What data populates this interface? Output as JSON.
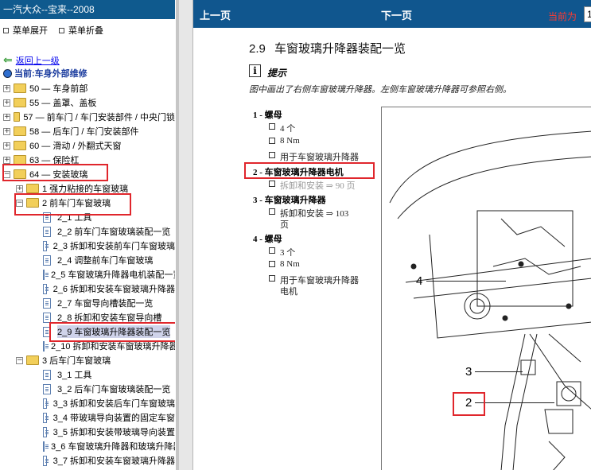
{
  "left": {
    "title": "一汽大众--宝来--2008",
    "menu": {
      "expand": "菜单展开",
      "collapse": "菜单折叠"
    },
    "back": "返回上一级",
    "current": "当前:车身外部维修",
    "tree": [
      {
        "toggle": "+",
        "label": "50 — 车身前部"
      },
      {
        "toggle": "+",
        "label": "55 — 盖罩、盖板"
      },
      {
        "toggle": "+",
        "label": "57 — 前车门 / 车门安装部件 / 中央门锁"
      },
      {
        "toggle": "+",
        "label": "58 — 后车门 / 车门安装部件"
      },
      {
        "toggle": "+",
        "label": "60 — 滑动 / 外翻式天窗"
      },
      {
        "toggle": "+",
        "label": "63 — 保险杠"
      },
      {
        "toggle": "−",
        "label": "64 — 安装玻璃"
      },
      {
        "toggle": "+",
        "label": "1 强力粘接的车窗玻璃"
      },
      {
        "toggle": "−",
        "label": "2 前车门车窗玻璃"
      },
      {
        "label": "2_1 工具"
      },
      {
        "label": "2_2 前车门车窗玻璃装配一览"
      },
      {
        "label": "2_3 拆卸和安装前车门车窗玻璃"
      },
      {
        "label": "2_4 调整前车门车窗玻璃"
      },
      {
        "label": "2_5 车窗玻璃升降器电机装配一览"
      },
      {
        "label": "2_6 拆卸和安装车窗玻璃升降器"
      },
      {
        "label": "2_7 车窗导向槽装配一览"
      },
      {
        "label": "2_8 拆卸和安装车窗导向槽"
      },
      {
        "label": "2_9 车窗玻璃升降器装配一览"
      },
      {
        "label": "2_10 拆卸和安装车窗玻璃升降器电机"
      },
      {
        "toggle": "−",
        "label": "3 后车门车窗玻璃"
      },
      {
        "label": "3_1 工具"
      },
      {
        "label": "3_2 后车门车窗玻璃装配一览"
      },
      {
        "label": "3_3 拆卸和安装后车门车窗玻璃"
      },
      {
        "label": "3_4 带玻璃导向装置的固定车窗"
      },
      {
        "label": "3_5 拆卸和安装带玻璃导向装置"
      },
      {
        "label": "3_6 车窗玻璃升降器和玻璃升降器"
      },
      {
        "label": "3_7 拆卸和安装车窗玻璃升降器"
      }
    ]
  },
  "right": {
    "nav": {
      "prev": "上一页",
      "next": "下一页",
      "page_label": "当前为",
      "page_value": "1"
    },
    "section_num": "2.9",
    "section_title": "车窗玻璃升降器装配一览",
    "tip_icon": "i",
    "tip_title": "提示",
    "tip_body": "图中画出了右侧车窗玻璃升降器。左侧车窗玻璃升降器可参照右侧。",
    "items": [
      {
        "n": "1 - 螺母",
        "subs": [
          "4 个",
          "8 Nm",
          "用于车窗玻璃升降器"
        ]
      },
      {
        "n": "2 - 车窗玻璃升降器电机",
        "subs": [
          "拆卸和安装 ⇒ 90 页"
        ]
      },
      {
        "n": "3 - 车窗玻璃升降器",
        "subs": [
          "拆卸和安装 ⇒ 103",
          "页"
        ]
      },
      {
        "n": "4 - 螺母",
        "subs": [
          "3 个",
          "8 Nm",
          "用于车窗玻璃升降器",
          "电机"
        ]
      }
    ],
    "callouts": [
      "4",
      "3",
      "2"
    ]
  },
  "colors": {
    "header": "#10568e",
    "highlight": "#e0262c",
    "folder": "#f2cf5a"
  }
}
